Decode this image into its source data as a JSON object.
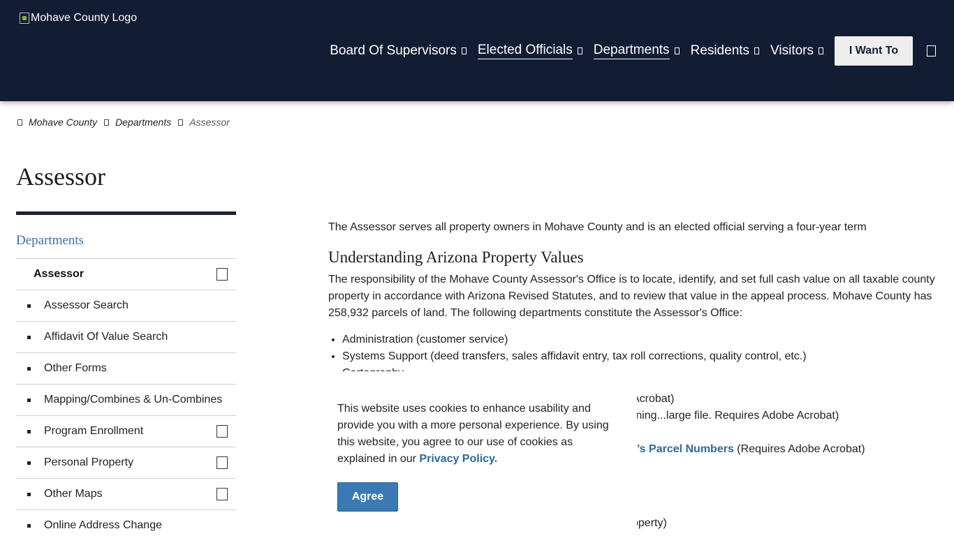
{
  "header": {
    "logo_alt": "Mohave County Logo",
    "nav": [
      {
        "label": "Board Of Supervisors",
        "underlined": false
      },
      {
        "label": "Elected Officials",
        "underlined": true
      },
      {
        "label": "Departments",
        "underlined": true
      },
      {
        "label": "Residents",
        "underlined": false
      },
      {
        "label": "Visitors",
        "underlined": false
      }
    ],
    "cta_label": "I Want To"
  },
  "breadcrumb": {
    "items": [
      "Mohave County",
      "Departments"
    ],
    "current": "Assessor"
  },
  "page": {
    "title": "Assessor"
  },
  "sidebar": {
    "heading": "Departments",
    "current": "Assessor",
    "items": [
      {
        "label": "Assessor Search",
        "expandable": false
      },
      {
        "label": "Affidavit Of Value Search",
        "expandable": false
      },
      {
        "label": "Other Forms",
        "expandable": false
      },
      {
        "label": "Mapping/Combines & Un-Combines",
        "expandable": false
      },
      {
        "label": "Program Enrollment",
        "expandable": true
      },
      {
        "label": "Personal Property",
        "expandable": true
      },
      {
        "label": "Other Maps",
        "expandable": true
      },
      {
        "label": "Online Address Change",
        "expandable": false
      }
    ]
  },
  "main": {
    "intro": "The Assessor serves all property owners in Mohave County and is an elected official serving a four-year term",
    "heading": "Understanding Arizona Property Values",
    "paragraph": "The responsibility of the Mohave County Assessor's Office is to locate, identify, and set full cash value on all taxable county property in accordance with Arizona Revised Statutes, and to review that value in the appeal process. Mohave County has 258,932 parcels of land. The following departments constitute the Assessor's Office:",
    "list": [
      "Administration (customer service)",
      "Systems Support (deed transfers, sales affidavit entry, tax roll corrections, quality control, etc.)",
      "Cartography"
    ],
    "fragments": {
      "f1": "Acrobat)",
      "f2": "rning...large file. Requires Adobe Acrobat)",
      "f3_link": "r’s Parcel Numbers",
      "f3_rest": " (Requires Adobe Acrobat)",
      "f4": "operty)"
    }
  },
  "cookie": {
    "text": "This website uses cookies to enhance usability and provide you with a more personal experience. By using this website, you agree to our use of cookies as explained in our ",
    "link": "Privacy Policy.",
    "button": "Agree"
  }
}
